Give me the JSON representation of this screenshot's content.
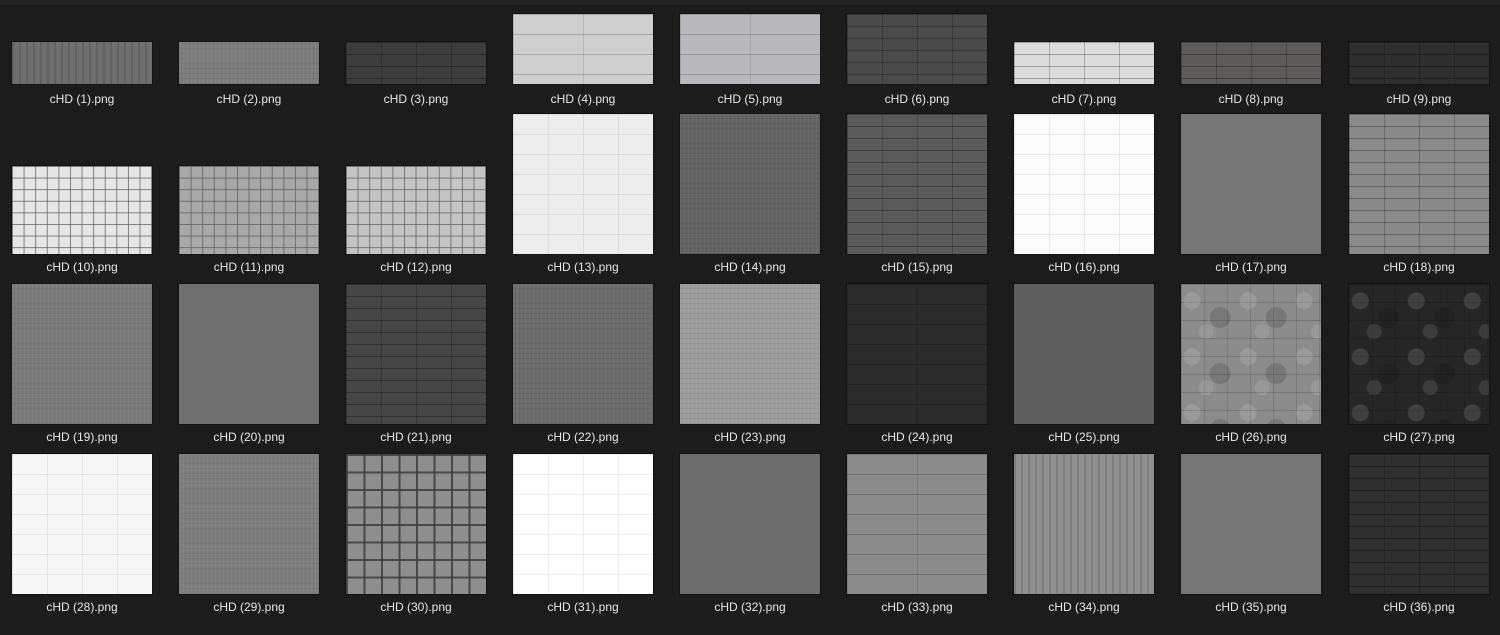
{
  "files": [
    {
      "name": "cHD (1).png",
      "color": "#6e6e6e",
      "pattern": "p-stripes",
      "aspect": "wide"
    },
    {
      "name": "cHD (2).png",
      "color": "#7c7c7c",
      "pattern": "p-grain",
      "aspect": "wide"
    },
    {
      "name": "cHD (3).png",
      "color": "#3c3c3c",
      "pattern": "p-brick",
      "aspect": "wide"
    },
    {
      "name": "cHD (4).png",
      "color": "#cfcfcf",
      "pattern": "p-slab",
      "aspect": "square-short"
    },
    {
      "name": "cHD (5).png",
      "color": "#b9b9bd",
      "pattern": "p-slab",
      "aspect": "square-short"
    },
    {
      "name": "cHD (6).png",
      "color": "#4a4a4a",
      "pattern": "p-brick",
      "aspect": "square-short"
    },
    {
      "name": "cHD (7).png",
      "color": "#dcdcdc",
      "pattern": "p-brick",
      "aspect": "wide"
    },
    {
      "name": "cHD (8).png",
      "color": "#5d5a5a",
      "pattern": "p-brick",
      "aspect": "wide"
    },
    {
      "name": "cHD (9).png",
      "color": "#2e2e2e",
      "pattern": "p-brick",
      "aspect": "wide"
    },
    {
      "name": "cHD (10).png",
      "color": "#e6e6e6",
      "pattern": "p-tile",
      "aspect": "tile"
    },
    {
      "name": "cHD (11).png",
      "color": "#a9a9a9",
      "pattern": "p-tile",
      "aspect": "tile"
    },
    {
      "name": "cHD (12).png",
      "color": "#c4c4c4",
      "pattern": "p-tile",
      "aspect": "tile"
    },
    {
      "name": "cHD (13).png",
      "color": "#ededed",
      "pattern": "p-wgrid",
      "aspect": "square"
    },
    {
      "name": "cHD (14).png",
      "color": "#636363",
      "pattern": "p-grain",
      "aspect": "square"
    },
    {
      "name": "cHD (15).png",
      "color": "#5a5a5a",
      "pattern": "p-brick",
      "aspect": "square"
    },
    {
      "name": "cHD (16).png",
      "color": "#fbfbfb",
      "pattern": "p-wgrid",
      "aspect": "square"
    },
    {
      "name": "cHD (17).png",
      "color": "#777777",
      "pattern": "p-flat",
      "aspect": "square"
    },
    {
      "name": "cHD (18).png",
      "color": "#8a8a8a",
      "pattern": "p-brick",
      "aspect": "square"
    },
    {
      "name": "cHD (19).png",
      "color": "#7a7a7a",
      "pattern": "p-grain",
      "aspect": "square"
    },
    {
      "name": "cHD (20).png",
      "color": "#6f6f6f",
      "pattern": "p-flat",
      "aspect": "square"
    },
    {
      "name": "cHD (21).png",
      "color": "#454545",
      "pattern": "p-brick",
      "aspect": "square"
    },
    {
      "name": "cHD (22).png",
      "color": "#6c6c6c",
      "pattern": "p-grain",
      "aspect": "square"
    },
    {
      "name": "cHD (23).png",
      "color": "#9c9c9c",
      "pattern": "p-grain",
      "aspect": "square"
    },
    {
      "name": "cHD (24).png",
      "color": "#2b2b2b",
      "pattern": "p-slab",
      "aspect": "square"
    },
    {
      "name": "cHD (25).png",
      "color": "#5e5e5e",
      "pattern": "p-flat",
      "aspect": "square"
    },
    {
      "name": "cHD (26).png",
      "color": "#8c8c8c",
      "pattern": "p-blotch",
      "aspect": "square"
    },
    {
      "name": "cHD (27).png",
      "color": "#262626",
      "pattern": "p-blotch",
      "aspect": "square"
    },
    {
      "name": "cHD (28).png",
      "color": "#f7f7f7",
      "pattern": "p-wgrid",
      "aspect": "square"
    },
    {
      "name": "cHD (29).png",
      "color": "#7d7d7d",
      "pattern": "p-grain",
      "aspect": "square"
    },
    {
      "name": "cHD (30).png",
      "color": "#8e8e8e",
      "pattern": "p-tileb",
      "aspect": "square"
    },
    {
      "name": "cHD (31).png",
      "color": "#ffffff",
      "pattern": "p-wgrid",
      "aspect": "square"
    },
    {
      "name": "cHD (32).png",
      "color": "#6d6d6d",
      "pattern": "p-flat",
      "aspect": "square"
    },
    {
      "name": "cHD (33).png",
      "color": "#8b8b8b",
      "pattern": "p-slab",
      "aspect": "square"
    },
    {
      "name": "cHD (34).png",
      "color": "#8f8f8f",
      "pattern": "p-stripes",
      "aspect": "square"
    },
    {
      "name": "cHD (35).png",
      "color": "#767676",
      "pattern": "p-flat",
      "aspect": "square"
    },
    {
      "name": "cHD (36).png",
      "color": "#2f2f2f",
      "pattern": "p-brick",
      "aspect": "square"
    }
  ]
}
